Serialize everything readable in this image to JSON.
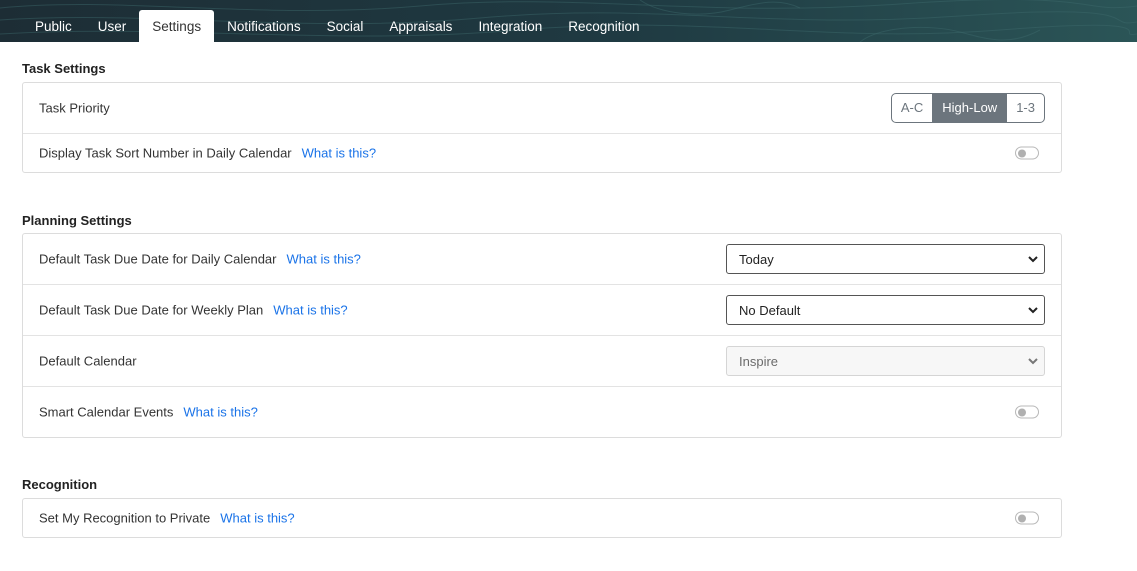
{
  "tabs": [
    {
      "label": "Public"
    },
    {
      "label": "User"
    },
    {
      "label": "Settings",
      "active": true
    },
    {
      "label": "Notifications"
    },
    {
      "label": "Social"
    },
    {
      "label": "Appraisals"
    },
    {
      "label": "Integration"
    },
    {
      "label": "Recognition"
    }
  ],
  "task_settings": {
    "title": "Task Settings",
    "priority_label": "Task Priority",
    "priority_options": [
      "A-C",
      "High-Low",
      "1-3"
    ],
    "priority_selected": "High-Low",
    "sort_number_label": "Display Task Sort Number in Daily Calendar",
    "sort_number_on": false
  },
  "planning_settings": {
    "title": "Planning Settings",
    "daily_due_label": "Default Task Due Date for Daily Calendar",
    "daily_due_value": "Today",
    "weekly_due_label": "Default Task Due Date for Weekly Plan",
    "weekly_due_value": "No Default",
    "calendar_label": "Default Calendar",
    "calendar_value": "Inspire",
    "smart_events_label": "Smart Calendar Events",
    "smart_events_on": false
  },
  "recognition": {
    "title": "Recognition",
    "private_label": "Set My Recognition to Private",
    "private_on": false
  },
  "help_link": "What is this?",
  "colors": {
    "topbar": "#1f3a42",
    "link": "#1a73e8",
    "segment_active": "#6c757d"
  }
}
